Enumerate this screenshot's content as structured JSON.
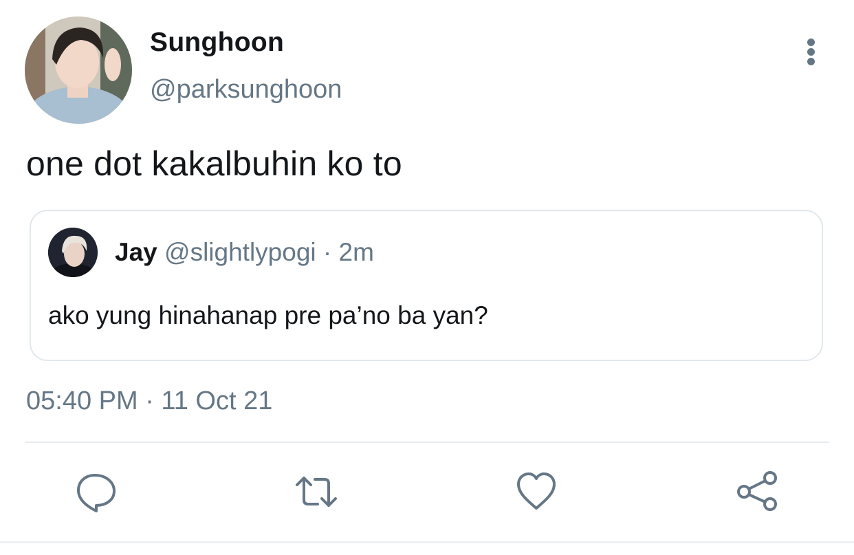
{
  "author": {
    "display_name": "Sunghoon",
    "handle": "@parksunghoon"
  },
  "tweet": {
    "text": "one dot kakalbuhin ko to",
    "timestamp": "05:40 PM · 11 Oct 21"
  },
  "quoted_tweet": {
    "display_name": "Jay",
    "handle": "@slightlypogi",
    "separator": "·",
    "time_ago": "2m",
    "text": "ako yung hinahanap pre pa’no ba yan?"
  },
  "actions": {
    "reply_icon": "speech-bubble-icon",
    "retweet_icon": "retweet-arrows-icon",
    "like_icon": "heart-icon",
    "share_icon": "share-nodes-icon"
  },
  "menu_icon": "vertical-ellipsis-icon",
  "colors": {
    "text_primary": "#14171a",
    "text_secondary": "#657786",
    "border": "#e1e8ed",
    "icon": "#657786"
  }
}
